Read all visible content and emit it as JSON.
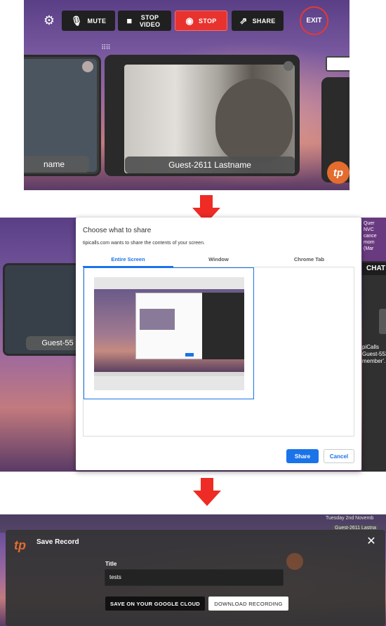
{
  "panel1": {
    "toolbar": {
      "mute_label": "MUTE",
      "stop_video_label": "STOP VIDEO",
      "stop_label": "STOP",
      "share_label": "SHARE",
      "exit_label": "EXIT"
    },
    "participants": [
      {
        "name": "name"
      },
      {
        "name": "Guest-2611 Lastname"
      }
    ],
    "logo_text": "tp"
  },
  "panel2": {
    "background_participant": "Guest-55",
    "chat_header": "CHAT",
    "chat_snippet": "Quer NVC cance mom (Mar",
    "chat_lines": [
      "piCalls",
      "Guest-553",
      "member'."
    ],
    "dialog": {
      "title": "Choose what to share",
      "subtitle": "tipicalls.com wants to share the contents of your screen.",
      "tabs": [
        "Entire Screen",
        "Window",
        "Chrome Tab"
      ],
      "active_tab": "Entire Screen",
      "share_button": "Share",
      "cancel_button": "Cancel"
    }
  },
  "panel3": {
    "timestamp": "Tuesday 2nd Novemb",
    "ghost_name": "Guest-2611 Lastna",
    "modal": {
      "logo_text": "tp",
      "title": "Save Record",
      "field_label": "Title",
      "field_value": "tests",
      "google_cloud_button": "SAVE ON YOUR GOOGLE CLOUD",
      "download_button": "DOWNLOAD RECORDING"
    }
  },
  "colors": {
    "accent_red": "#ee2b24",
    "stop_red": "#e8322e",
    "brand_orange": "#e36c2e",
    "chrome_blue": "#1a73e8"
  }
}
